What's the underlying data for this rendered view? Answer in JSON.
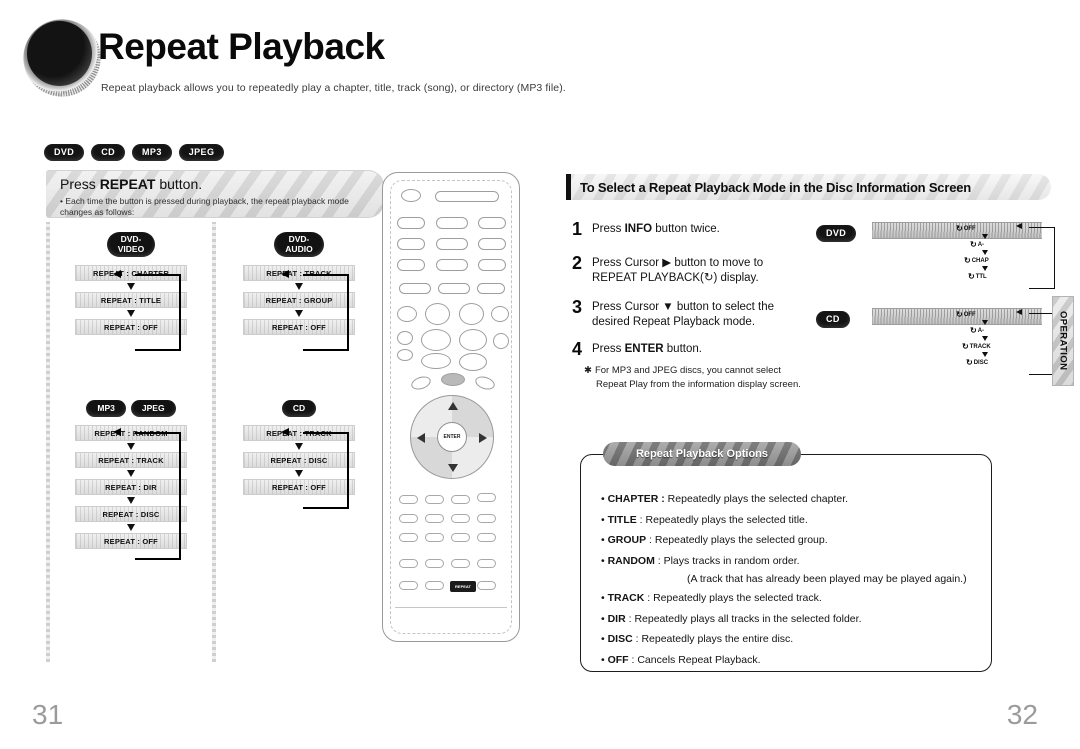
{
  "header": {
    "title": "Repeat Playback",
    "subtitle": "Repeat playback allows you to repeatedly play a chapter, title, track (song), or directory (MP3 file).",
    "disc_icon": "cd-disc-icon"
  },
  "disc_badges": [
    "DVD",
    "CD",
    "MP3",
    "JPEG"
  ],
  "left_page": {
    "instruction_title_prefix": "Press ",
    "instruction_title_bold": "REPEAT",
    "instruction_title_suffix": " button.",
    "instruction_note": "• Each time the button is pressed during playback, the repeat playback mode changes as follows:",
    "flows": [
      {
        "labels": [
          "DVD-",
          "VIDEO"
        ],
        "steps": [
          "REPEAT : CHAPTER",
          "REPEAT : TITLE",
          "REPEAT : OFF"
        ]
      },
      {
        "labels": [
          "DVD-",
          "AUDIO"
        ],
        "steps": [
          "REPEAT : TRACK",
          "REPEAT : GROUP",
          "REPEAT : OFF"
        ]
      },
      {
        "labels": [
          "MP3",
          "JPEG"
        ],
        "steps": [
          "REPEAT : RANDOM",
          "REPEAT : TRACK",
          "REPEAT : DIR",
          "REPEAT : DISC",
          "REPEAT : OFF"
        ]
      },
      {
        "labels": [
          "CD"
        ],
        "steps": [
          "REPEAT : TRACK",
          "REPEAT : DISC",
          "REPEAT : OFF"
        ]
      }
    ]
  },
  "remote": {
    "enter_label": "ENTER",
    "repeat_key_label": "REPEAT"
  },
  "right_page": {
    "section_title": "To Select a Repeat Playback Mode in the Disc Information Screen",
    "steps": [
      {
        "num": "1",
        "text": "Press INFO button twice.",
        "bold": "INFO"
      },
      {
        "num": "2",
        "text": "Press Cursor ▶ button to move to REPEAT PLAYBACK(↻) display.",
        "line1": "Press Cursor ▶ button to move to",
        "line2": "REPEAT PLAYBACK(↻) display."
      },
      {
        "num": "3",
        "text": "Press Cursor ▼ button to select the desired Repeat Playback mode.",
        "line1": "Press Cursor ▼ button to select the",
        "line2": "desired Repeat Playback mode."
      },
      {
        "num": "4",
        "text": "Press ENTER button.",
        "bold": "ENTER"
      }
    ],
    "footnote_line1": "For MP3 and JPEG discs, you cannot select",
    "footnote_line2": "Repeat Play from the information display screen.",
    "footnote_marker": "✱",
    "disc_displays": [
      {
        "disc": "DVD",
        "modes": [
          "OFF",
          "A-",
          "CHAP",
          "TTL"
        ]
      },
      {
        "disc": "CD",
        "modes": [
          "OFF",
          "A-",
          "TRACK",
          "DISC"
        ]
      }
    ],
    "options": {
      "badge": "Repeat Playback Options",
      "items": [
        {
          "term": "CHAPTER :",
          "desc": " Repeatedly plays the selected chapter."
        },
        {
          "term": "TITLE",
          "desc": " : Repeatedly plays the selected title."
        },
        {
          "term": "GROUP",
          "desc": " : Repeatedly plays the selected group."
        },
        {
          "term": "RANDOM",
          "desc": " : Plays tracks in random order.",
          "sub": "(A track that has already been played may be played again.)"
        },
        {
          "term": "TRACK",
          "desc": " : Repeatedly plays the selected track."
        },
        {
          "term": "DIR",
          "desc": " : Repeatedly plays all tracks in the selected folder."
        },
        {
          "term": "DISC",
          "desc": " : Repeatedly plays the entire disc."
        },
        {
          "term": "OFF",
          "desc": " : Cancels Repeat Playback."
        }
      ]
    }
  },
  "side_tab": "OPERATION",
  "page_numbers": {
    "left": "31",
    "right": "32"
  }
}
